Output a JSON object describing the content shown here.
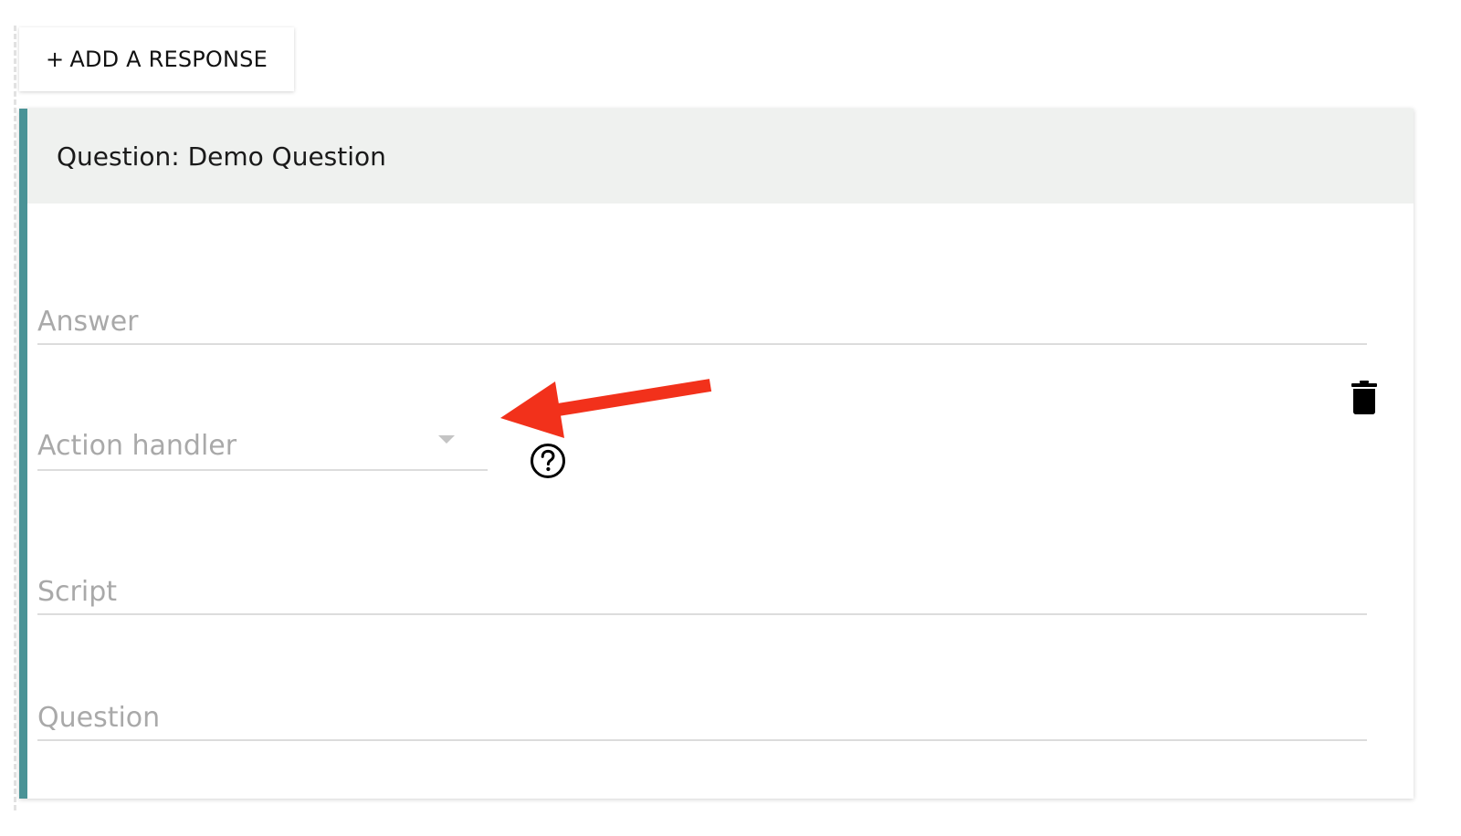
{
  "toolbar": {
    "add_response_plus": "+",
    "add_response_label": "ADD A RESPONSE"
  },
  "card": {
    "title": "Question: Demo Question",
    "accent_color": "#4a9396",
    "header_bg": "#eff1ef"
  },
  "fields": {
    "answer_placeholder": "Answer",
    "action_handler_label": "Action handler",
    "script_placeholder": "Script",
    "question_placeholder": "Question"
  },
  "icons": {
    "help": "help-circle-icon",
    "trash": "trash-icon",
    "dropdown": "chevron-down-icon",
    "annotation": "red-arrow-annotation"
  },
  "annotation_color": "#f2311b"
}
